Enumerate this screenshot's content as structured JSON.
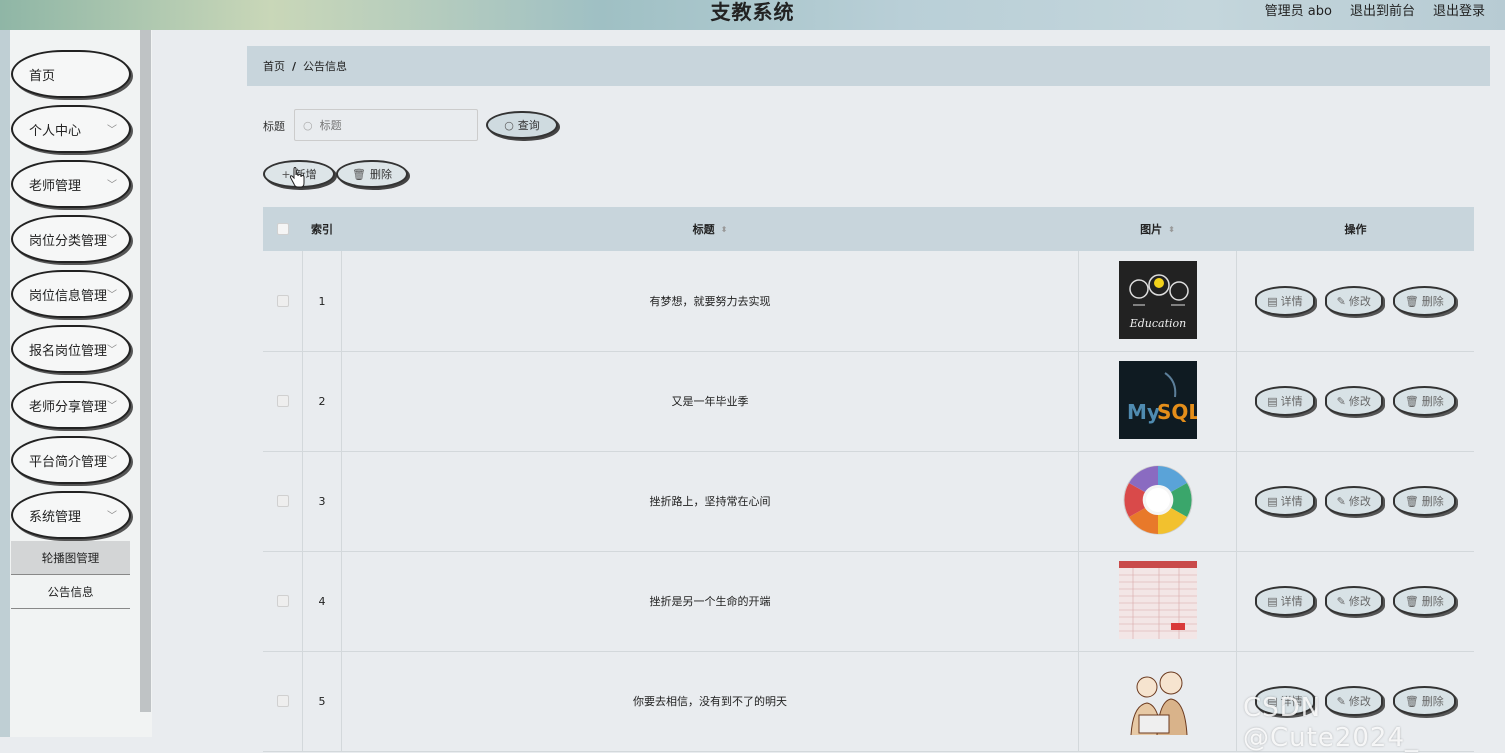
{
  "header": {
    "title": "支教系统",
    "user_label": "管理员 abo",
    "front_link": "退出到前台",
    "logout_link": "退出登录"
  },
  "sidebar": {
    "items": [
      {
        "label": "首页"
      },
      {
        "label": "个人中心"
      },
      {
        "label": "老师管理"
      },
      {
        "label": "岗位分类管理"
      },
      {
        "label": "岗位信息管理"
      },
      {
        "label": "报名岗位管理"
      },
      {
        "label": "老师分享管理"
      },
      {
        "label": "平台简介管理"
      },
      {
        "label": "系统管理"
      }
    ],
    "subitems": [
      {
        "label": "轮播图管理"
      },
      {
        "label": "公告信息"
      }
    ]
  },
  "breadcrumb": {
    "home": "首页",
    "sep": "/",
    "current": "公告信息"
  },
  "search": {
    "label": "标题",
    "placeholder": "标题",
    "query_button": "查询"
  },
  "toolbar": {
    "add_label": "新增",
    "delete_label": "删除"
  },
  "table": {
    "headers": {
      "index": "索引",
      "title": "标题",
      "image": "图片",
      "actions": "操作"
    },
    "rows": [
      {
        "index": "1",
        "title": "有梦想，就要努力去实现",
        "image": "education-chalkboard"
      },
      {
        "index": "2",
        "title": "又是一年毕业季",
        "image": "mysql-logo"
      },
      {
        "index": "3",
        "title": "挫折路上，坚持常在心间",
        "image": "circular-infographic"
      },
      {
        "index": "4",
        "title": "挫折是另一个生命的开端",
        "image": "red-table-sheet"
      },
      {
        "index": "5",
        "title": "你要去相信，没有到不了的明天",
        "image": "sketch-two-people"
      }
    ],
    "row_actions": {
      "detail": "详情",
      "edit": "修改",
      "delete": "删除"
    }
  },
  "watermark": "CSDN @Cute2024_"
}
